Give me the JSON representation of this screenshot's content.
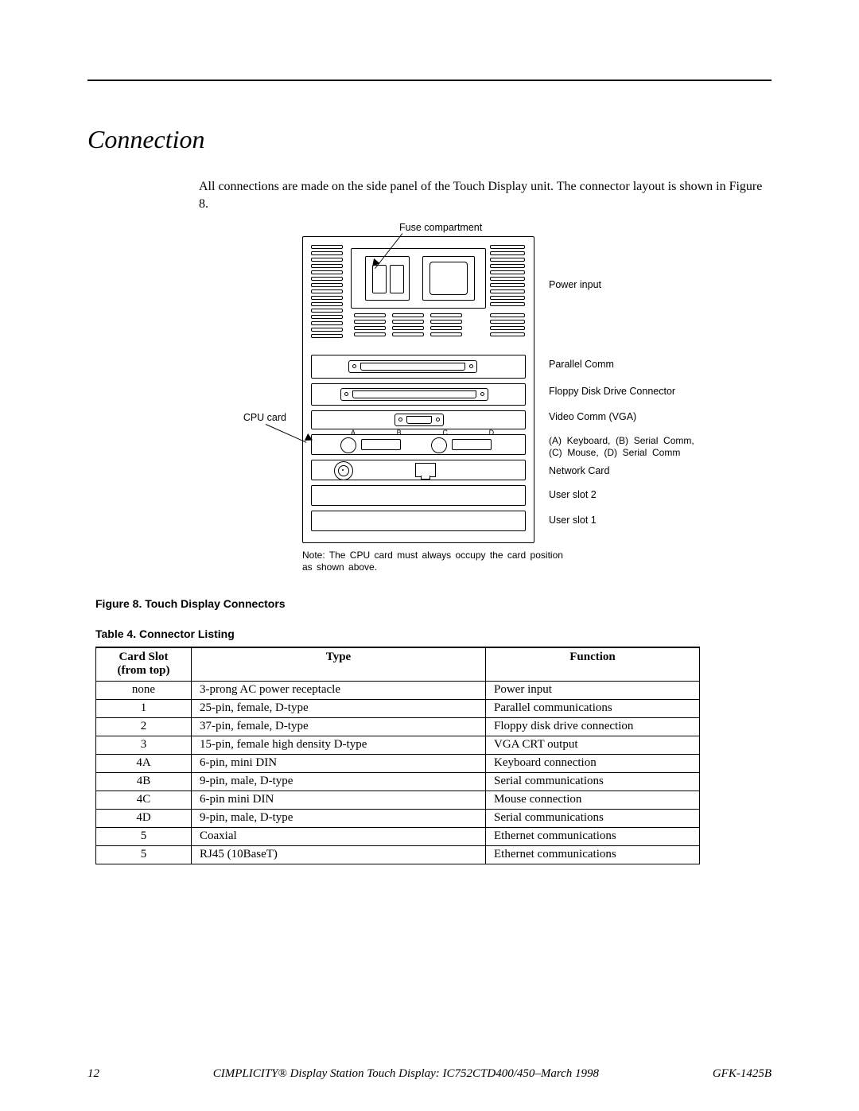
{
  "section_title": "Connection",
  "intro": "All connections are made on the side panel of the Touch Display unit. The connector layout is shown in Figure 8.",
  "figure": {
    "labels": {
      "fuse": "Fuse compartment",
      "power": "Power  input",
      "parallel": "Parallel Comm",
      "floppy": "Floppy  Disk  Drive  Connector",
      "video": "Video  Comm  (VGA)",
      "abcd": "(A)  Keyboard,  (B)  Serial  Comm,\n(C)  Mouse,  (D)  Serial  Comm",
      "network": "Network  Card",
      "user2": "User  slot  2",
      "user1": "User  slot  1",
      "cpu": "CPU card",
      "letters": [
        "A",
        "B",
        "C",
        "D"
      ]
    },
    "note": "Note: The CPU card must always occupy the card position as shown above.",
    "caption": "Figure 8.  Touch Display Connectors"
  },
  "table": {
    "caption": "Table 4.  Connector Listing",
    "headers": [
      "Card Slot\n(from top)",
      "Type",
      "Function"
    ],
    "rows": [
      [
        "none",
        "3-prong AC power receptacle",
        "Power input"
      ],
      [
        "1",
        "25-pin, female, D-type",
        "Parallel communications"
      ],
      [
        "2",
        "37-pin, female, D-type",
        "Floppy disk drive connection"
      ],
      [
        "3",
        "15-pin, female high density D-type",
        "VGA CRT output"
      ],
      [
        "4A",
        "6-pin, mini DIN",
        "Keyboard connection"
      ],
      [
        "4B",
        "9-pin, male,  D-type",
        "Serial communications"
      ],
      [
        "4C",
        "6-pin mini DIN",
        "Mouse connection"
      ],
      [
        "4D",
        "9-pin, male, D-type",
        "Serial communications"
      ],
      [
        "5",
        "Coaxial",
        "Ethernet communications"
      ],
      [
        "5",
        "RJ45 (10BaseT)",
        "Ethernet communications"
      ]
    ]
  },
  "footer": {
    "page": "12",
    "center": "CIMPLICITY® Display Station Touch Display: IC752CTD400/450–March 1998",
    "right": "GFK-1425B"
  }
}
